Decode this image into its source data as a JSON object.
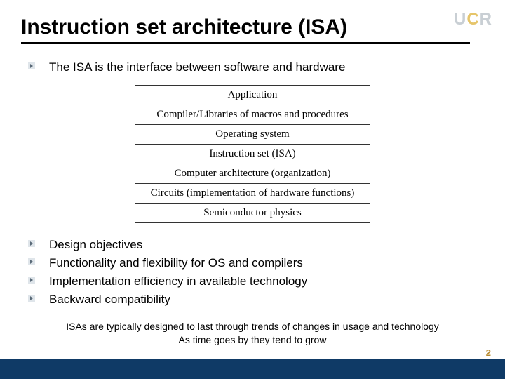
{
  "logo": {
    "u": "U",
    "c": "C",
    "r": "R"
  },
  "title": "Instruction set architecture (ISA)",
  "intro_bullet": "The ISA is the interface between software and hardware",
  "stack_layers": [
    "Application",
    "Compiler/Libraries of macros and procedures",
    "Operating system",
    "Instruction set (ISA)",
    "Computer architecture (organization)",
    "Circuits (implementation of hardware functions)",
    "Semiconductor physics"
  ],
  "lower_bullets": [
    "Design objectives",
    "Functionality and flexibility for OS and compilers",
    "Implementation efficiency in available technology",
    "Backward compatibility"
  ],
  "footnote_line1": "ISAs are typically designed to last through trends of changes in usage and technology",
  "footnote_line2": "As time goes by they tend to grow",
  "page_number": "2"
}
